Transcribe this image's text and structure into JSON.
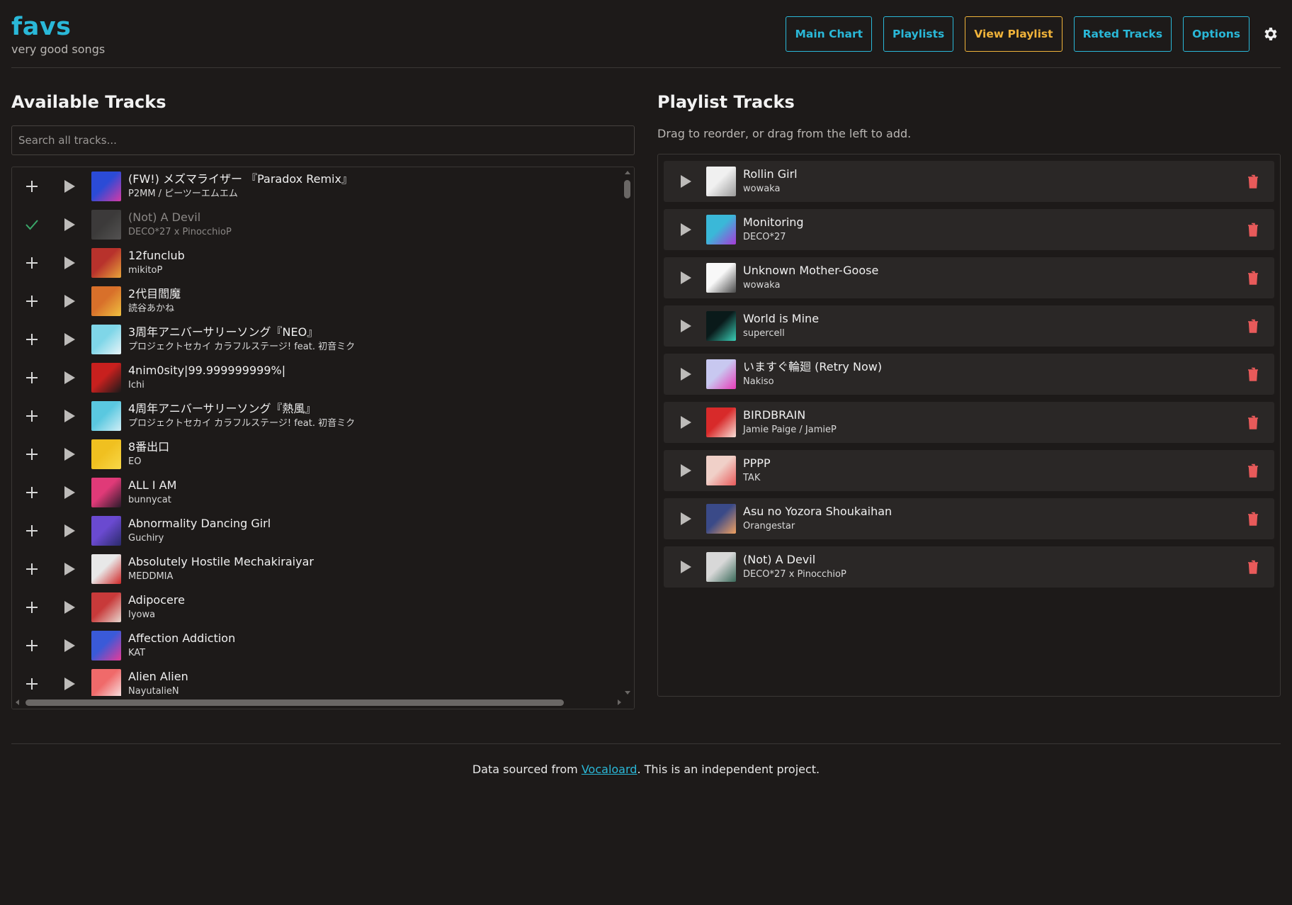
{
  "brand": {
    "title": "favs",
    "subtitle": "very good songs"
  },
  "nav": {
    "items": [
      {
        "label": "Main Chart",
        "active": false
      },
      {
        "label": "Playlists",
        "active": false
      },
      {
        "label": "View Playlist",
        "active": true
      },
      {
        "label": "Rated Tracks",
        "active": false
      },
      {
        "label": "Options",
        "active": false
      }
    ],
    "settings_icon": "gear-icon"
  },
  "available": {
    "title": "Available Tracks",
    "search_placeholder": "Search all tracks...",
    "tracks": [
      {
        "title": "(FW!) メズマライザー 『Paradox Remix』",
        "artist": "P2MM / ピーツーエムエム",
        "added": false,
        "art": [
          "#2b4bd6",
          "#d63aa6"
        ]
      },
      {
        "title": "(Not) A Devil",
        "artist": "DECO*27 x PinocchioP",
        "added": true,
        "art": [
          "#5a5a5a",
          "#8a8a8a"
        ]
      },
      {
        "title": "12funclub",
        "artist": "mikitoP",
        "added": false,
        "art": [
          "#b8322c",
          "#e8a43a"
        ]
      },
      {
        "title": "2代目閻魔",
        "artist": "読谷あかね",
        "added": false,
        "art": [
          "#d8702a",
          "#f0c040"
        ]
      },
      {
        "title": "3周年アニバーサリーソング『NEO』",
        "artist": "プロジェクトセカイ カラフルステージ! feat. 初音ミク",
        "added": false,
        "art": [
          "#7fd6e8",
          "#e8f4f8"
        ]
      },
      {
        "title": "4nim0sity|99.999999999%|",
        "artist": "Ichi",
        "added": false,
        "art": [
          "#c8201e",
          "#1a1a1a"
        ]
      },
      {
        "title": "4周年アニバーサリーソング『熱風』",
        "artist": "プロジェクトセカイ カラフルステージ! feat. 初音ミク",
        "added": false,
        "art": [
          "#5ac8e0",
          "#d0eef6"
        ]
      },
      {
        "title": "8番出口",
        "artist": "EO",
        "added": false,
        "art": [
          "#f0c020",
          "#f8d848"
        ]
      },
      {
        "title": "ALL I AM",
        "artist": "bunnycat",
        "added": false,
        "art": [
          "#e03a78",
          "#2a1a2a"
        ]
      },
      {
        "title": "Abnormality Dancing Girl",
        "artist": "Guchiry",
        "added": false,
        "art": [
          "#6a4ad0",
          "#2a2a6a"
        ]
      },
      {
        "title": "Absolutely Hostile Mechakiraiyar",
        "artist": "MEDDMIA",
        "added": false,
        "art": [
          "#e8e8e8",
          "#d02828"
        ]
      },
      {
        "title": "Adipocere",
        "artist": "Iyowa",
        "added": false,
        "art": [
          "#c83a3a",
          "#e8d8d0"
        ]
      },
      {
        "title": "Affection Addiction",
        "artist": "KAT",
        "added": false,
        "art": [
          "#3a5ad8",
          "#e83a98"
        ]
      },
      {
        "title": "Alien Alien",
        "artist": "NayutalieN",
        "added": false,
        "art": [
          "#f06a6a",
          "#f8e8e8"
        ]
      }
    ]
  },
  "playlist": {
    "title": "Playlist Tracks",
    "hint": "Drag to reorder, or drag from the left to add.",
    "tracks": [
      {
        "title": "Rollin Girl",
        "artist": "wowaka",
        "art": [
          "#f0f0f0",
          "#9a9a9a"
        ]
      },
      {
        "title": "Monitoring",
        "artist": "DECO*27",
        "art": [
          "#3ab8d8",
          "#a83ad8"
        ]
      },
      {
        "title": "Unknown Mother-Goose",
        "artist": "wowaka",
        "art": [
          "#f8f8f8",
          "#4a4a4a"
        ]
      },
      {
        "title": "World is Mine",
        "artist": "supercell",
        "art": [
          "#0a1a1a",
          "#3ad0b8"
        ]
      },
      {
        "title": "いますぐ輪廻 (Retry Now)",
        "artist": "Nakiso",
        "art": [
          "#c8c8f0",
          "#e83ab8"
        ]
      },
      {
        "title": "BIRDBRAIN",
        "artist": "Jamie Paige / JamieP",
        "art": [
          "#d82a2a",
          "#f8e0d8"
        ]
      },
      {
        "title": "PPPP",
        "artist": "TAK",
        "art": [
          "#f0d0c8",
          "#e85a5a"
        ]
      },
      {
        "title": "Asu no Yozora Shoukaihan",
        "artist": "Orangestar",
        "art": [
          "#3a4a88",
          "#f0a060"
        ]
      },
      {
        "title": "(Not) A Devil",
        "artist": "DECO*27 x PinocchioP",
        "art": [
          "#d8d8d8",
          "#3a6a5a"
        ]
      }
    ]
  },
  "footer": {
    "prefix": "Data sourced from ",
    "link": "Vocaloard",
    "suffix": ". This is an independent project."
  },
  "colors": {
    "accent": "#2ab8d8",
    "active": "#f0b33a",
    "delete": "#e85a5a",
    "added_check": "#3aa86a"
  }
}
